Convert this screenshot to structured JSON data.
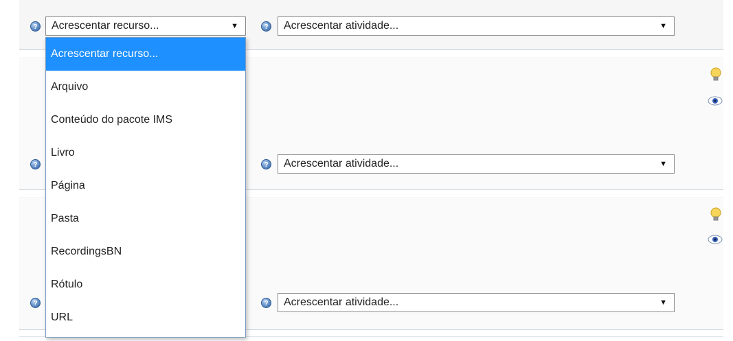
{
  "help_glyph": "?",
  "resource_select": {
    "value": "Acrescentar recurso...",
    "options": [
      "Acrescentar recurso...",
      "Arquivo",
      "Conteúdo do pacote IMS",
      "Livro",
      "Página",
      "Pasta",
      "RecordingsBN",
      "Rótulo",
      "URL"
    ]
  },
  "activity_selects": [
    {
      "value": "Acrescentar atividade..."
    },
    {
      "value": "Acrescentar atividade..."
    },
    {
      "value": "Acrescentar atividade..."
    }
  ],
  "arrow_glyph": "▼",
  "icons": {
    "help": "help-icon",
    "highlight": "lightbulb-icon",
    "visibility": "eye-icon"
  },
  "colors": {
    "dropdown_selected": "#1e90ff",
    "section_bg": "#f6f6f6",
    "help_blue": "#2f5f9e"
  }
}
